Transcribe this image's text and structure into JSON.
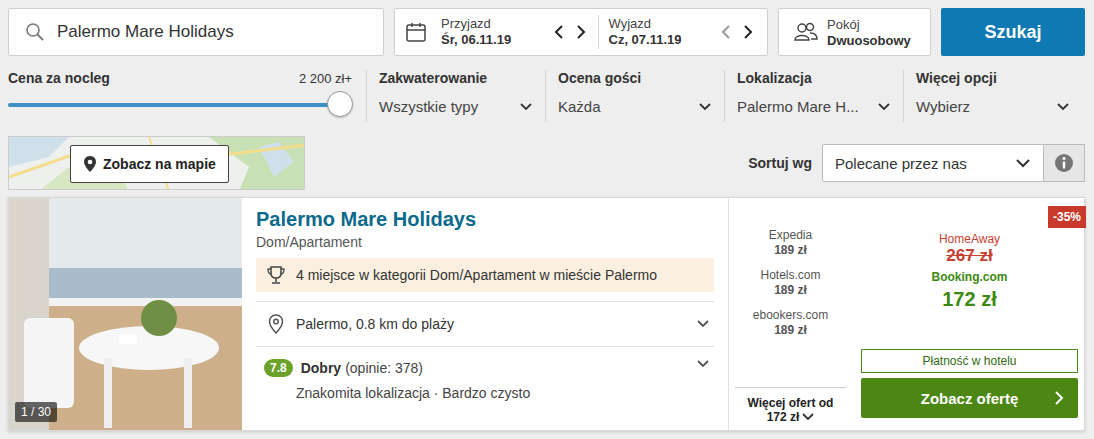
{
  "search": {
    "query": "Palermo Mare Holidays"
  },
  "dates": {
    "checkin_label": "Przyjazd",
    "checkin": "Śr, 06.11.19",
    "checkout_label": "Wyjazd",
    "checkout": "Cz, 07.11.19"
  },
  "room": {
    "label": "Pokój",
    "value": "Dwuosobowy"
  },
  "search_button": "Szukaj",
  "price_filter": {
    "label": "Cena za nocleg",
    "reading": "2 200 zł+",
    "level": 1
  },
  "filters": [
    {
      "label": "Zakwaterowanie",
      "value": "Wszystkie typy"
    },
    {
      "label": "Ocena gości",
      "value": "Każda"
    },
    {
      "label": "Lokalizacja",
      "value": "Palermo Mare H..."
    },
    {
      "label": "Więcej opcji",
      "value": "Wybierz"
    }
  ],
  "map_button": "Zobacz na mapie",
  "sort": {
    "label": "Sortuj wg",
    "value": "Polecane przez nas"
  },
  "result": {
    "name": "Palermo Mare Holidays",
    "type": "Dom/Apartament",
    "photo_counter": "1 / 30",
    "award": "4 miejsce w kategorii Dom/Apartament w mieście Palermo",
    "location": "Palermo, 0.8 km do plaży",
    "rating": {
      "score": "7.8",
      "label": "Dobry",
      "count": "(opinie: 378)",
      "highlights": "Znakomita lokalizacja · Bardzo czysto"
    },
    "other_offers": [
      {
        "site": "Expedia",
        "price": "189 zł"
      },
      {
        "site": "Hotels.com",
        "price": "189 zł"
      },
      {
        "site": "ebookers.com",
        "price": "189 zł"
      }
    ],
    "more_offers": {
      "label": "Więcej ofert od",
      "price": "172 zł"
    },
    "deal": {
      "discount": "-35%",
      "old_site": "HomeAway",
      "old_price": "267 zł",
      "site": "Booking.com",
      "price": "172 zł",
      "payment": "Płatność w hotelu",
      "button": "Zobacz ofertę"
    }
  }
}
